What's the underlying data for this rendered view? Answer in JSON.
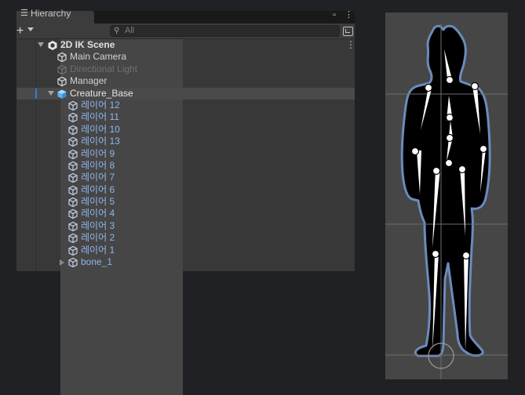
{
  "hierarchy": {
    "tab_title": "Hierarchy",
    "tab_icon": "list-icon",
    "search_placeholder": "All",
    "add_label": "+",
    "menu_glyph": "⋮",
    "scene_name": "2D IK Scene",
    "root_items": [
      {
        "label": "Main Camera",
        "state": "normal"
      },
      {
        "label": "Directional Light",
        "state": "disabled"
      },
      {
        "label": "Manager",
        "state": "normal"
      }
    ],
    "selected_item": "Creature_Base",
    "children": [
      "레이어 12",
      "레이어 11",
      "레이어 10",
      "레이어 13",
      "레이어 9",
      "레이어 8",
      "레이어 7",
      "레이어 6",
      "레이어 5",
      "레이어 4",
      "레이어 3",
      "레이어 2",
      "레이어 1"
    ],
    "bone_item": "bone_1"
  },
  "colors": {
    "panel_bg": "#383838",
    "selected_bg": "#4a4a4a",
    "prefab_text": "#8fb6ec",
    "scene_bg": "#464646",
    "sprite_outline": "#6a8bbd"
  }
}
